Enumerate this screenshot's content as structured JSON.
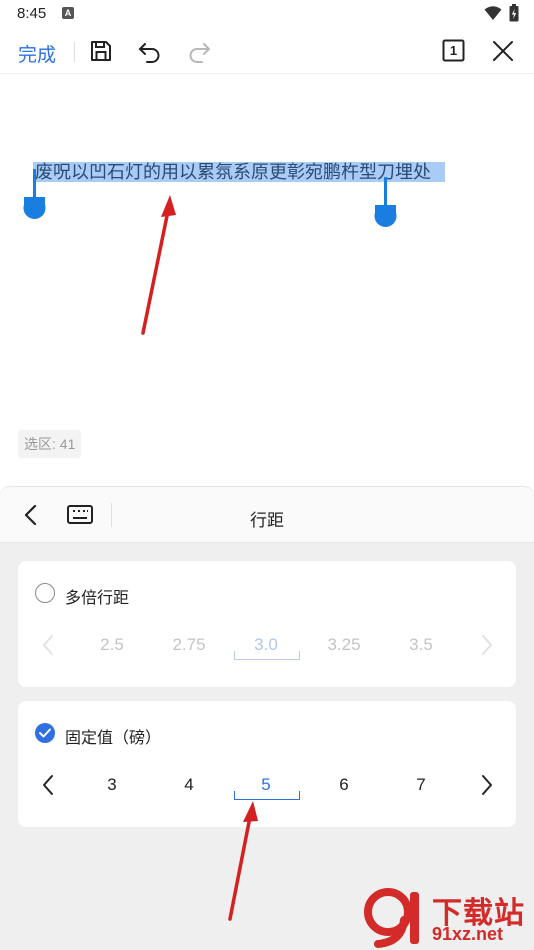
{
  "status": {
    "time": "8:45",
    "indicator": "A"
  },
  "toolbar": {
    "done_label": "完成",
    "icons": [
      "save-icon",
      "undo-icon",
      "redo-icon",
      "page-count-icon",
      "close-icon"
    ],
    "page_count": "1"
  },
  "document": {
    "selected_text": "废呪以凹石灯的用以累氛系原更彰宛鹏杵型刀埋处",
    "selection_count": "选区: 41"
  },
  "panel": {
    "title": "行距",
    "multiple_option": {
      "label": "多倍行距",
      "checked": false,
      "values": [
        "2.5",
        "2.75",
        "3.0",
        "3.25",
        "3.5"
      ],
      "selected": "3.0"
    },
    "fixed_option": {
      "label": "固定值（磅）",
      "checked": true,
      "values": [
        "3",
        "4",
        "5",
        "6",
        "7"
      ],
      "selected": "5"
    }
  },
  "watermark": {
    "title": "下载站",
    "sub": "91xz.net"
  },
  "colors": {
    "accent": "#2f6fe0",
    "annotation_arrow": "#d42020",
    "selection": "#a8ccf5"
  }
}
